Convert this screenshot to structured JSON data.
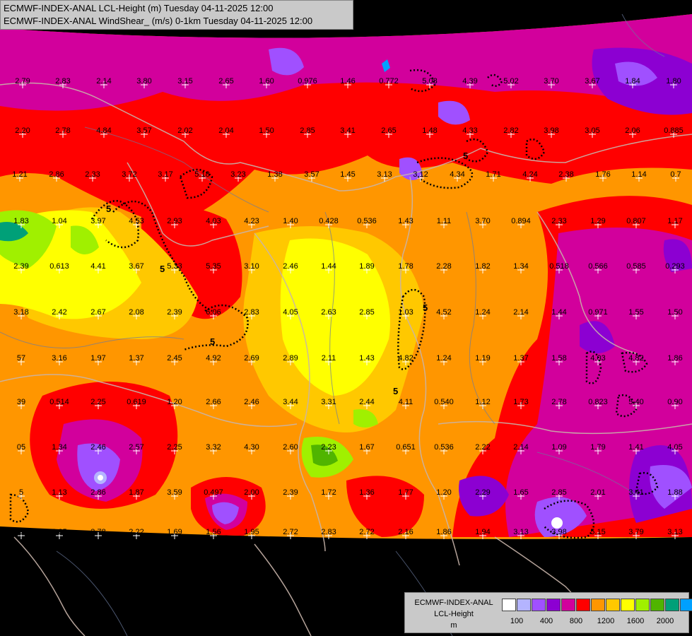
{
  "title_lines": [
    "ECMWF-INDEX-ANAL LCL-Height (m) Tuesday 04-11-2025 12:00",
    "ECMWF-INDEX-ANAL WindShear_ (m/s) 0-1km Tuesday 04-11-2025 12:00"
  ],
  "legend": {
    "label_lines": [
      "ECMWF-INDEX-ANAL",
      "LCL-Height",
      "m"
    ],
    "colors": [
      "#ffffff",
      "#b4b4ff",
      "#a050ff",
      "#8c00d2",
      "#d2009c",
      "#ff0000",
      "#ff9600",
      "#ffc800",
      "#ffff00",
      "#a0f000",
      "#50b400",
      "#00a078",
      "#00a0ff"
    ],
    "ticks": [
      "100",
      "400",
      "800",
      "1200",
      "1600",
      "2000"
    ]
  },
  "contour_label": "5",
  "shear_values": [
    [
      "2.79",
      "2.83",
      "2.14",
      "3.80",
      "3.15",
      "2.65",
      "1.60",
      "0.976",
      "1.46",
      "0.772",
      "5.08",
      "4.39",
      "5.02",
      "3.70",
      "3.67",
      "1.84",
      "1.80"
    ],
    [
      "2.20",
      "2.78",
      "4.84",
      "3.57",
      "2.02",
      "2.04",
      "1.50",
      "2.85",
      "3.41",
      "2.65",
      "1.48",
      "4.33",
      "2.82",
      "3.98",
      "3.05",
      "2.06",
      "0.885"
    ],
    [
      "1.21",
      "2.86",
      "2.33",
      "3.72",
      "3.17",
      "5.18",
      "3.23",
      "1.38",
      "3.57",
      "1.45",
      "3.13",
      "3.12",
      "4.34",
      "1.71",
      "4.24",
      "2.38",
      "1.76",
      "1.14",
      "0.7"
    ],
    [
      "1.83",
      "1.04",
      "3.97",
      "4.53",
      "2.93",
      "4.03",
      "4.23",
      "1.40",
      "0.428",
      "0.536",
      "1.43",
      "1.11",
      "3.70",
      "0.894",
      "2.33",
      "1.29",
      "0.807",
      "1.17"
    ],
    [
      "2.39",
      "0.613",
      "4.41",
      "3.67",
      "5.33",
      "5.35",
      "3.10",
      "2.46",
      "1.44",
      "1.89",
      "1.78",
      "2.28",
      "1.82",
      "1.34",
      "0.518",
      "0.566",
      "0.585",
      "0.293"
    ],
    [
      "3.18",
      "2.42",
      "2.67",
      "2.08",
      "2.39",
      "6.06",
      "2.83",
      "4.05",
      "2.63",
      "2.85",
      "1.03",
      "4.52",
      "1.24",
      "2.14",
      "1.44",
      "0.971",
      "1.55",
      "1.50"
    ],
    [
      "57",
      "3.16",
      "1.97",
      "1.37",
      "2.45",
      "4.92",
      "2.69",
      "2.89",
      "2.11",
      "1.43",
      "4.82",
      "1.24",
      "1.19",
      "1.37",
      "1.58",
      "4.03",
      "4.82",
      "1.86"
    ],
    [
      "39",
      "0.514",
      "2.25",
      "0.619",
      "1.20",
      "2.66",
      "2.46",
      "3.44",
      "3.31",
      "2.44",
      "4.11",
      "0.540",
      "1.12",
      "1.73",
      "2.78",
      "0.823",
      "5.40",
      "0.90"
    ],
    [
      "05",
      "1.34",
      "2.46",
      "2.57",
      "2.25",
      "3.32",
      "4.30",
      "2.60",
      "2.23",
      "1.67",
      "0.651",
      "0.536",
      "2.22",
      "2.14",
      "1.09",
      "1.79",
      "1.41",
      "4.05"
    ],
    [
      "5",
      "1.13",
      "2.86",
      "1.87",
      "3.59",
      "0.497",
      "2.00",
      "2.39",
      "1.72",
      "1.36",
      "1.77",
      "1.20",
      "2.29",
      "1.65",
      "2.85",
      "2.01",
      "3.41",
      "1.88"
    ],
    [
      "3",
      "3.85",
      "2.78",
      "2.22",
      "1.69",
      "1.56",
      "1.95",
      "2.72",
      "2.83",
      "2.72",
      "2.16",
      "1.86",
      "1.94",
      "3.13",
      "3.98",
      "5.15",
      "3.79",
      "3.13"
    ]
  ]
}
